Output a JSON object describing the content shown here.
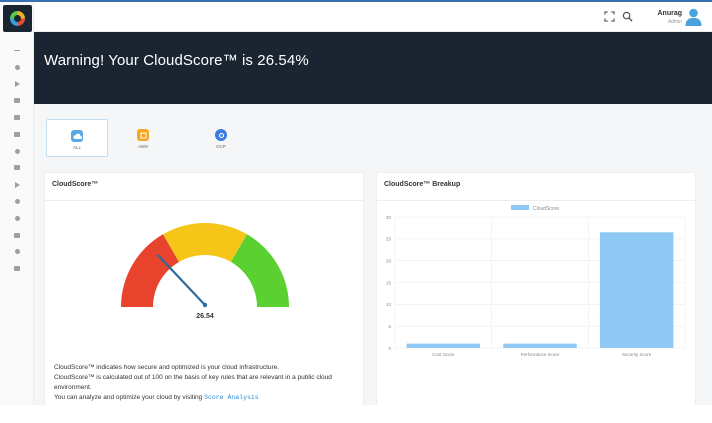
{
  "header": {
    "user_name": "Anurag",
    "user_role": "Admin",
    "icons": [
      "expand-icon",
      "search-icon",
      "user-avatar-icon"
    ]
  },
  "sidebar": {
    "icons": [
      "divider-icon",
      "dashboard-icon",
      "play-icon",
      "inventory-icon",
      "list-icon",
      "menu-icon",
      "globe-icon",
      "server-icon",
      "share-icon",
      "settings-icon",
      "bell-icon",
      "filter-icon",
      "support-icon",
      "grid-icon"
    ]
  },
  "banner": {
    "text": "Warning! Your CloudScore™ is 26.54%"
  },
  "providers": [
    {
      "label": "ALL",
      "icon": "cloud-icon",
      "color": "#5aa9e6",
      "active": true
    },
    {
      "label": "AWS",
      "icon": "aws-icon",
      "color": "#f5a623",
      "active": false
    },
    {
      "label": "GCP",
      "icon": "gcp-icon",
      "color": "#3b7ddd",
      "active": false
    }
  ],
  "score_card": {
    "title": "CloudScore™",
    "value_label": "26.54",
    "value": 26.54,
    "max": 100,
    "zone_colors": [
      "#e8432c",
      "#f5c518",
      "#5ad130"
    ],
    "description": [
      "CloudScore™ indicates how secure and optimized is your cloud infrastructure.",
      "CloudScore™ is calculated out of 100 on the basis of key rules that are relevant in a public cloud environment."
    ],
    "link_prefix": "You can analyze and optimize your cloud by visiting",
    "link_text": "Score Analysis"
  },
  "breakup_card": {
    "title": "CloudScore™ Breakup"
  },
  "chart_data": {
    "type": "bar",
    "title": "",
    "legend": [
      "CloudScore"
    ],
    "legend_position": "top-center",
    "categories": [
      "Cost Score",
      "Performance Score",
      "Security Score"
    ],
    "series": [
      {
        "name": "CloudScore",
        "values": [
          1.0,
          1.0,
          26.5
        ]
      }
    ],
    "ylim": [
      0,
      30
    ],
    "yticks": [
      "0",
      "5",
      "10",
      "15",
      "20",
      "25",
      "30"
    ],
    "bar_color": "#8fc8f5",
    "grid": true
  }
}
